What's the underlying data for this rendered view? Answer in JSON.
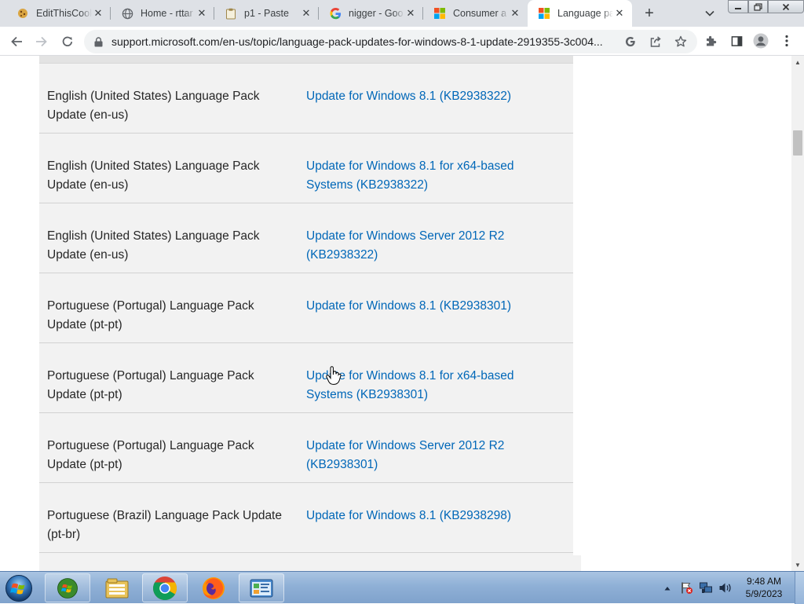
{
  "browser": {
    "tabs": [
      {
        "title": "EditThisCookie",
        "favicon": "cookie-icon",
        "active": false
      },
      {
        "title": "Home - rttar",
        "favicon": "globe-icon",
        "active": false
      },
      {
        "title": "p1 - Paste",
        "favicon": "clipboard-icon",
        "active": false
      },
      {
        "title": "nigger - Goo",
        "favicon": "google-icon",
        "active": false
      },
      {
        "title": "Consumer a",
        "favicon": "microsoft-icon",
        "active": false
      },
      {
        "title": "Language pa",
        "favicon": "microsoft-icon",
        "active": true
      }
    ],
    "url": "support.microsoft.com/en-us/topic/language-pack-updates-for-windows-8-1-update-2919355-3c004..."
  },
  "table": {
    "rows": [
      {
        "language": "English (United States) Language Pack Update (en-us)",
        "link": "Update for Windows 8.1 (KB2938322)"
      },
      {
        "language": "English (United States) Language Pack Update (en-us)",
        "link": "Update for Windows 8.1 for x64-based Systems (KB2938322)"
      },
      {
        "language": "English (United States) Language Pack Update (en-us)",
        "link": "Update for Windows Server 2012 R2 (KB2938322)"
      },
      {
        "language": "Portuguese (Portugal) Language Pack Update (pt-pt)",
        "link": "Update for Windows 8.1 (KB2938301)"
      },
      {
        "language": "Portuguese (Portugal) Language Pack Update (pt-pt)",
        "link": "Update for Windows 8.1 for x64-based Systems (KB2938301)"
      },
      {
        "language": "Portuguese (Portugal) Language Pack Update (pt-pt)",
        "link": "Update for Windows Server 2012 R2 (KB2938301)"
      },
      {
        "language": "Portuguese (Brazil) Language Pack Update (pt-br)",
        "link": "Update for Windows 8.1 (KB2938298)"
      }
    ]
  },
  "taskbar": {
    "apps": [
      "file-explorer",
      "chrome",
      "firefox",
      "control-panel"
    ],
    "clock": {
      "time": "9:48 AM",
      "date": "5/9/2023"
    }
  },
  "colors": {
    "link": "#0067b8",
    "tab_strip": "#dee1e6",
    "table_bg": "#f2f2f2"
  }
}
